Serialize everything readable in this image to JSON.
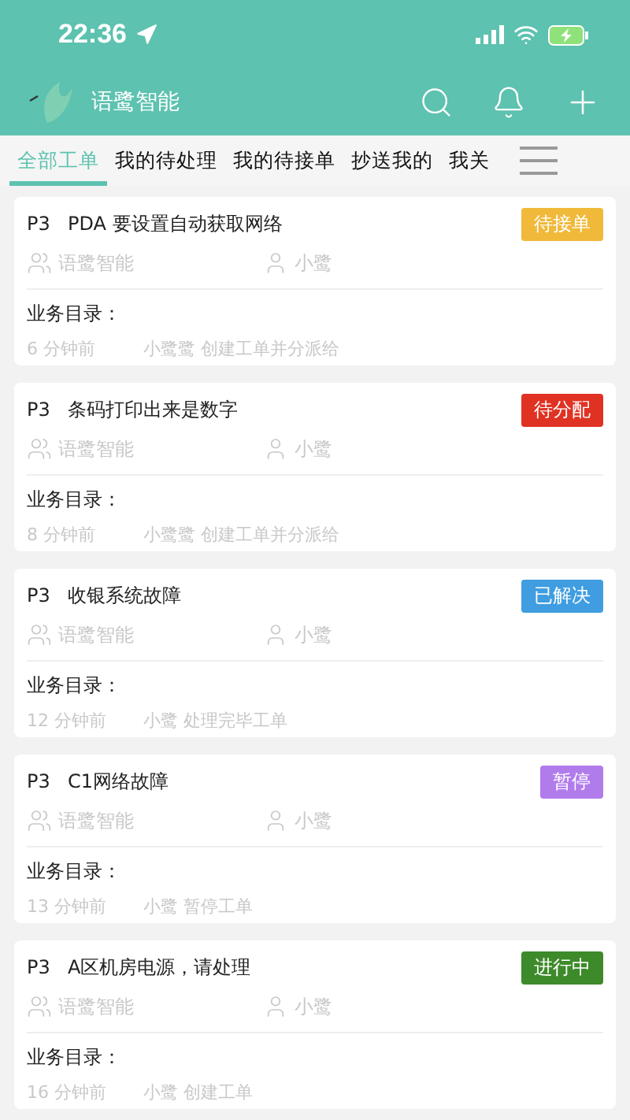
{
  "status_bar": {
    "time": "22:36"
  },
  "header": {
    "title": "语鹭智能"
  },
  "tabs": [
    {
      "label": "全部工单",
      "selected": true
    },
    {
      "label": "我的待处理",
      "selected": false
    },
    {
      "label": "我的待接单",
      "selected": false
    },
    {
      "label": "抄送我的",
      "selected": false
    },
    {
      "label": "我关",
      "selected": false
    }
  ],
  "tickets": [
    {
      "priority": "P3",
      "title": "PDA 要设置自动获取网络",
      "status": "待接单",
      "color": "#f0b93a",
      "team": "语鹭智能",
      "assignee": "小鹭",
      "catalog": "业务目录：",
      "time": "6 分钟前",
      "activity": "小鹭鹭 创建工单并分派给"
    },
    {
      "priority": "P3",
      "title": "条码打印出来是数字",
      "status": "待分配",
      "color": "#e03223",
      "team": "语鹭智能",
      "assignee": "小鹭",
      "catalog": "业务目录：",
      "time": "8 分钟前",
      "activity": "小鹭鹭 创建工单并分派给"
    },
    {
      "priority": "P3",
      "title": "收银系统故障",
      "status": "已解决",
      "color": "#3f9de0",
      "team": "语鹭智能",
      "assignee": "小鹭",
      "catalog": "业务目录：",
      "time": "12 分钟前",
      "activity": "小鹭 处理完毕工单"
    },
    {
      "priority": "P3",
      "title": "C1网络故障",
      "status": "暂停",
      "color": "#b07cec",
      "team": "语鹭智能",
      "assignee": "小鹭",
      "catalog": "业务目录：",
      "time": "13 分钟前",
      "activity": "小鹭 暂停工单"
    },
    {
      "priority": "P3",
      "title": "A区机房电源，请处理",
      "status": "进行中",
      "color": "#3d8a2a",
      "team": "语鹭智能",
      "assignee": "小鹭",
      "catalog": "业务目录：",
      "time": "16 分钟前",
      "activity": "小鹭 创建工单"
    }
  ]
}
